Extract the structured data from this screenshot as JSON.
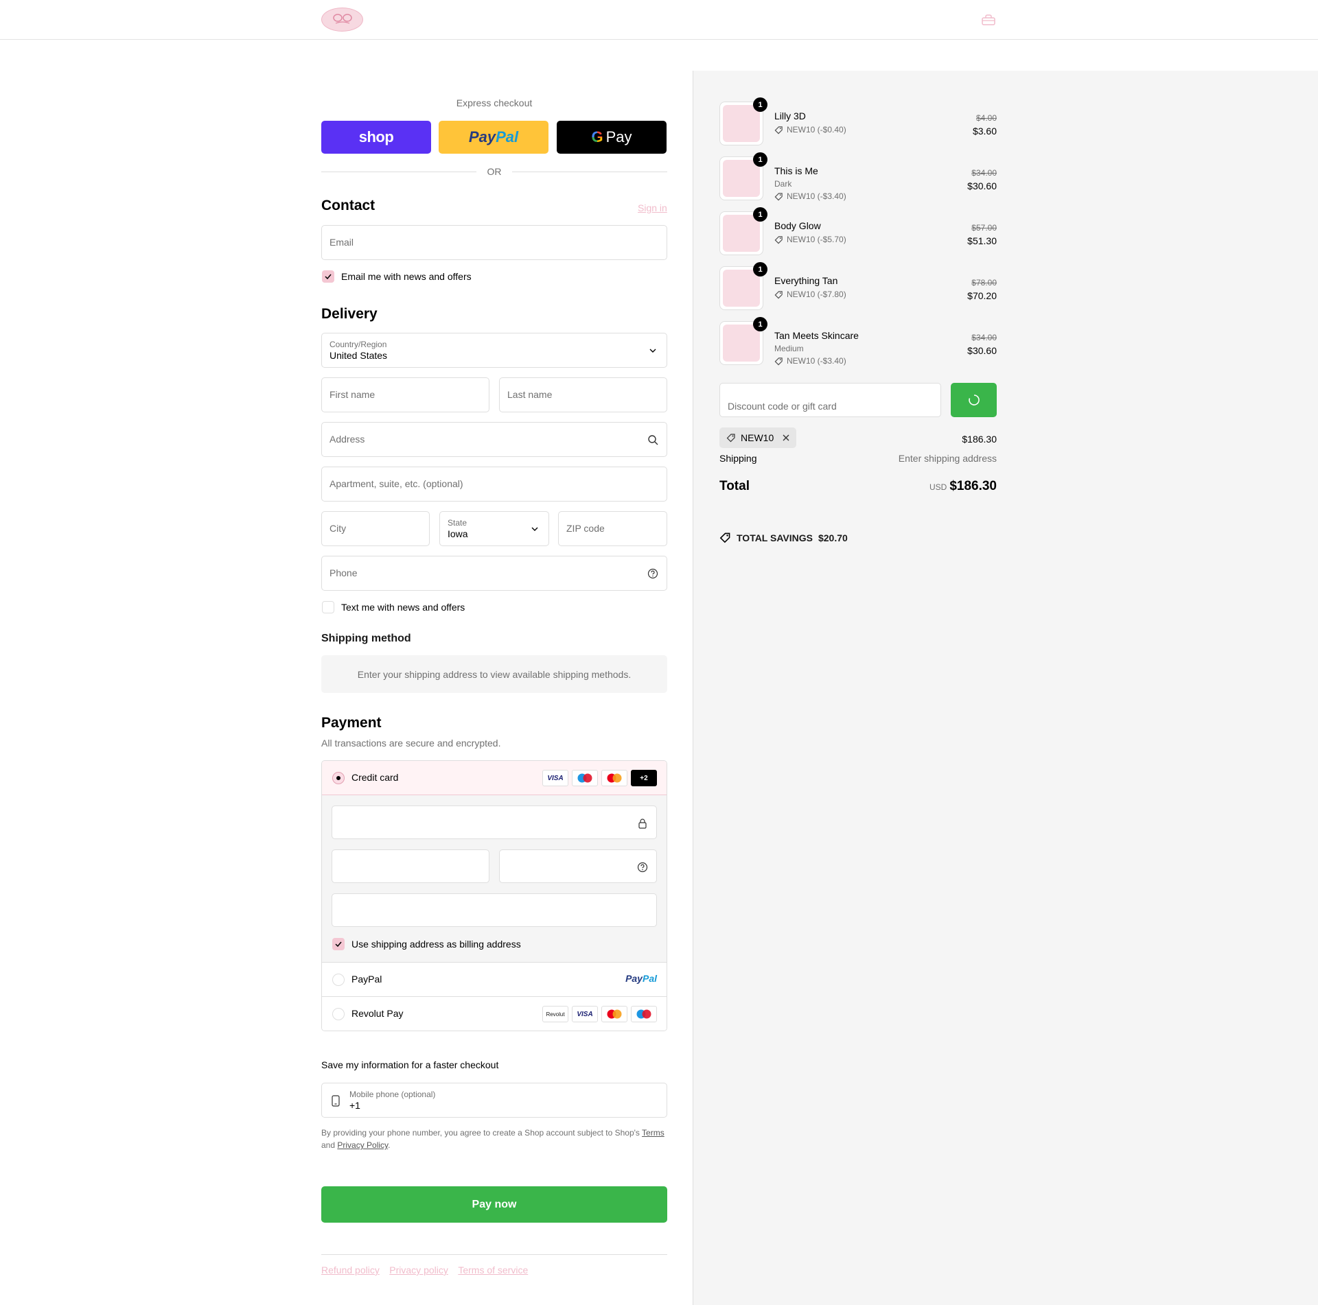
{
  "header": {
    "logo_text": "Eyelash logo",
    "cart_icon": "bag-icon"
  },
  "express": {
    "title": "Express checkout",
    "shop_label": "shop",
    "paypal_label_1": "Pay",
    "paypal_label_2": "Pal",
    "gpay_g": "G",
    "gpay_label": "Pay",
    "or": "OR"
  },
  "contact": {
    "heading": "Contact",
    "sign_in": "Sign in",
    "email_placeholder": "Email",
    "newsletter_label": "Email me with news and offers",
    "newsletter_checked": true
  },
  "delivery": {
    "heading": "Delivery",
    "country_label": "Country/Region",
    "country_value": "United States",
    "first_name": "First name",
    "last_name": "Last name",
    "address": "Address",
    "apartment": "Apartment, suite, etc. (optional)",
    "city": "City",
    "state_label": "State",
    "state_value": "Iowa",
    "zip": "ZIP code",
    "phone": "Phone",
    "sms_label": "Text me with news and offers",
    "sms_checked": false
  },
  "shipping_method": {
    "heading": "Shipping method",
    "notice": "Enter your shipping address to view available shipping methods."
  },
  "payment": {
    "heading": "Payment",
    "subtitle": "All transactions are secure and encrypted.",
    "credit_card_label": "Credit card",
    "card_logos": [
      "VISA",
      "maestro",
      "mastercard",
      "+2"
    ],
    "billing_same_label": "Use shipping address as billing address",
    "billing_same_checked": true,
    "paypal_label": "PayPal",
    "paypal_logo_1": "Pay",
    "paypal_logo_2": "Pal",
    "revolut_label": "Revolut Pay",
    "revolut_logos": [
      "Revolut",
      "VISA",
      "mastercard",
      "maestro"
    ]
  },
  "save_info": {
    "heading": "Save my information for a faster checkout",
    "mobile_label": "Mobile phone (optional)",
    "mobile_value": "+1",
    "legal_1": "By providing your phone number, you agree to create a Shop account subject to Shop's ",
    "terms": "Terms",
    "legal_2": "and ",
    "privacy": "Privacy Policy",
    "legal_3": "."
  },
  "pay_now": "Pay now",
  "footer": {
    "refund": "Refund policy",
    "privacy": "Privacy policy",
    "terms": "Terms of service"
  },
  "order": {
    "items": [
      {
        "name": "Lilly 3D",
        "variant": "",
        "discount": "NEW10 (-$0.40)",
        "original": "$4.00",
        "price": "$3.60",
        "qty": "1"
      },
      {
        "name": "This is Me",
        "variant": "Dark",
        "discount": "NEW10 (-$3.40)",
        "original": "$34.00",
        "price": "$30.60",
        "qty": "1"
      },
      {
        "name": "Body Glow",
        "variant": "",
        "discount": "NEW10 (-$5.70)",
        "original": "$57.00",
        "price": "$51.30",
        "qty": "1"
      },
      {
        "name": "Everything Tan",
        "variant": "",
        "discount": "NEW10 (-$7.80)",
        "original": "$78.00",
        "price": "$70.20",
        "qty": "1"
      },
      {
        "name": "Tan Meets Skincare",
        "variant": "Medium",
        "discount": "NEW10 (-$3.40)",
        "original": "$34.00",
        "price": "$30.60",
        "qty": "1"
      }
    ],
    "discount_placeholder": "Discount code or gift card",
    "applied_code": "NEW10",
    "subtotal": "$186.30",
    "shipping_label": "Shipping",
    "shipping_value": "Enter shipping address",
    "total_label": "Total",
    "currency": "USD",
    "total_value": "$186.30",
    "savings_label": "TOTAL SAVINGS",
    "savings_value": "$20.70"
  },
  "colors": {
    "accent_pink": "#f4c7d3",
    "green": "#3ab54a",
    "shop_purple": "#5a31f4",
    "paypal_yellow": "#ffc439"
  }
}
